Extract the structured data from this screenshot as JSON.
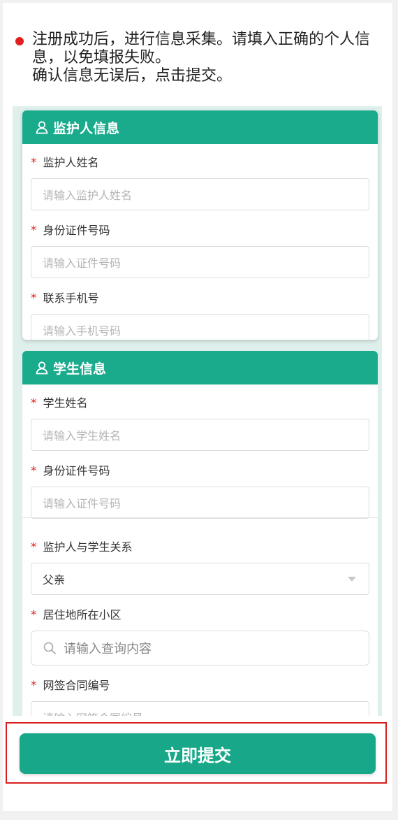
{
  "instruction": {
    "text": "注册成功后，进行信息采集。请填入正确的个人信息，以免填报失败。\n确认信息无误后，点击提交。"
  },
  "guardian_section": {
    "title": "监护人信息",
    "fields": [
      {
        "label": "监护人姓名",
        "placeholder": "请输入监护人姓名"
      },
      {
        "label": "身份证件号码",
        "placeholder": "请输入证件号码"
      },
      {
        "label": "联系手机号",
        "placeholder": "请输入手机号码"
      }
    ]
  },
  "student_section": {
    "title": "学生信息",
    "fields": [
      {
        "label": "学生姓名",
        "placeholder": "请输入学生姓名"
      },
      {
        "label": "身份证件号码",
        "placeholder": "请输入证件号码"
      }
    ],
    "relation": {
      "label": "监护人与学生关系",
      "value": "父亲"
    },
    "community": {
      "label": "居住地所在小区",
      "placeholder": "请输入查询内容"
    },
    "contract": {
      "label": "网签合同编号",
      "placeholder": "请输入网签合同编号"
    }
  },
  "required_mark": "*",
  "submit_label": "立即提交",
  "colors": {
    "accent": "#1aaa8c",
    "required": "#e02020",
    "highlight_frame": "#d71f1f",
    "form_background": "#dff0ec"
  },
  "icons": {
    "section_icon": "user-icon",
    "search_icon": "search-icon",
    "dropdown_icon": "chevron-down-icon",
    "bullet_icon": "bullet-dot-icon"
  }
}
